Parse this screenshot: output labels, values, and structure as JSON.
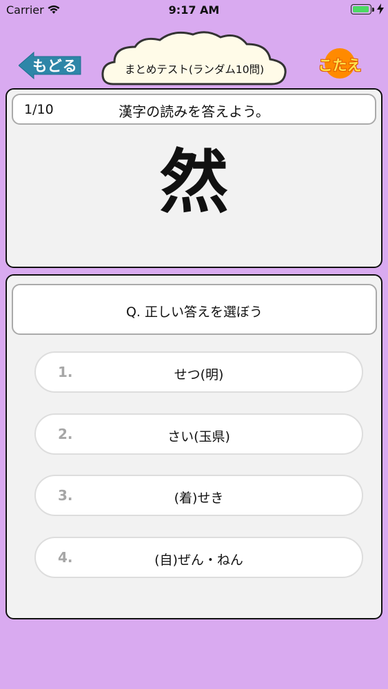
{
  "status_bar": {
    "carrier": "Carrier",
    "time": "9:17 AM",
    "wifi_icon": "wifi-icon",
    "battery_level": 1.0,
    "battery_color": "#4cd964",
    "charging_icon": "bolt-icon"
  },
  "header": {
    "back_label": "もどる",
    "title": "まとめテスト(ランダム10問)",
    "answer_label": "こたえ"
  },
  "question": {
    "counter": "1/10",
    "instruction": "漢字の読みを答えよう。",
    "kanji": "然"
  },
  "answers": {
    "prompt": "Q. 正しい答えを選ぼう",
    "options": [
      {
        "num": "1.",
        "text": "せつ(明)"
      },
      {
        "num": "2.",
        "text": "さい(玉県)"
      },
      {
        "num": "3.",
        "text": "(着)せき"
      },
      {
        "num": "4.",
        "text": "(自)ぜん・ねん"
      }
    ]
  },
  "colors": {
    "background": "#d9aaf0",
    "back_button": "#2e86a8",
    "answer_button": "#ff8a00",
    "answer_text": "#ffe34a",
    "panel": "#f2f2f2"
  }
}
